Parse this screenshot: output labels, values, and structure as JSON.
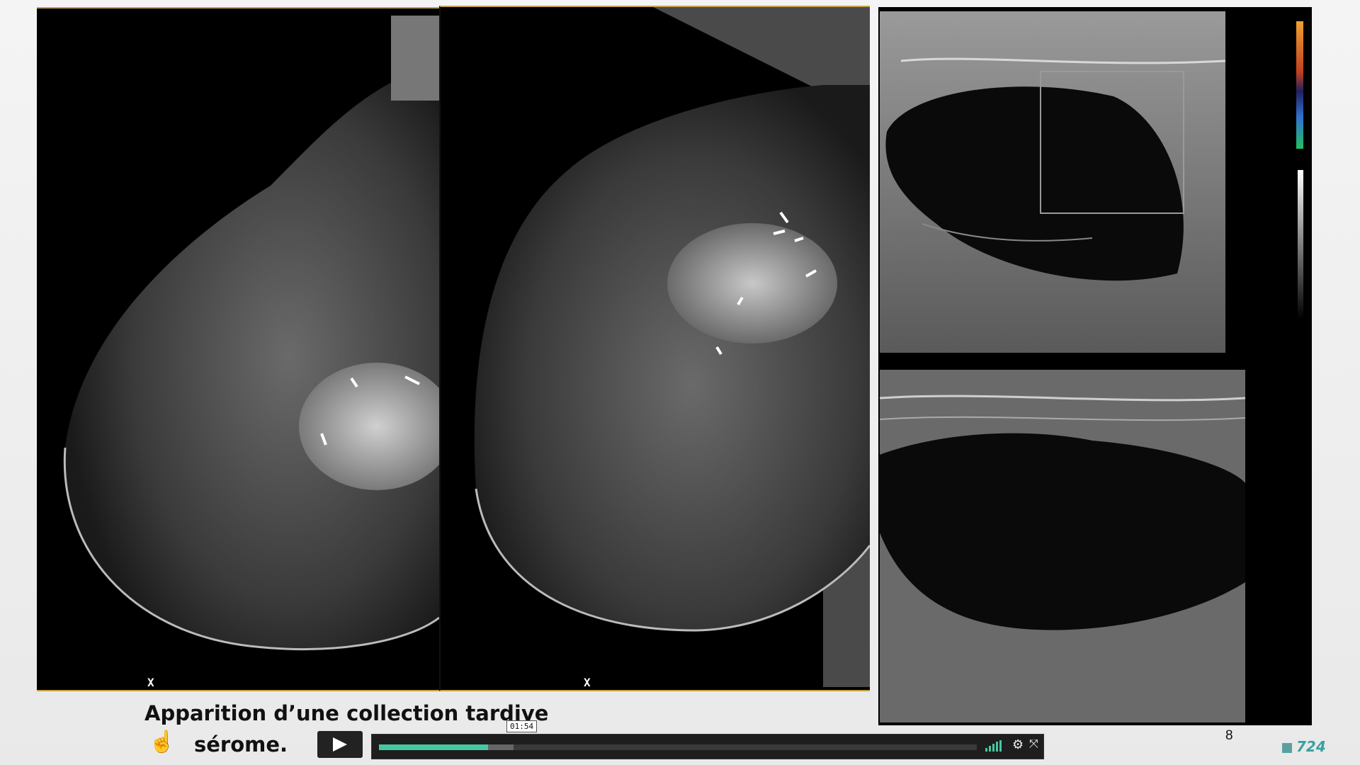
{
  "caption": {
    "line1": "Apparition d’une collection tardive",
    "line2": "sérome."
  },
  "hand_icon": "pointing-hand-icon",
  "page_number": "8",
  "logo_text": "724",
  "mammo_markers": [
    "X",
    "X"
  ],
  "player": {
    "time_tooltip": "01:54",
    "progress_fraction": 0.182,
    "buffered_fraction": 0.225,
    "icons": [
      "play-icon",
      "volume-icon",
      "gear-icon",
      "fullscreen-icon"
    ]
  },
  "colors": {
    "accent": "#46c7a3",
    "frame_border": "#c8a24a"
  }
}
